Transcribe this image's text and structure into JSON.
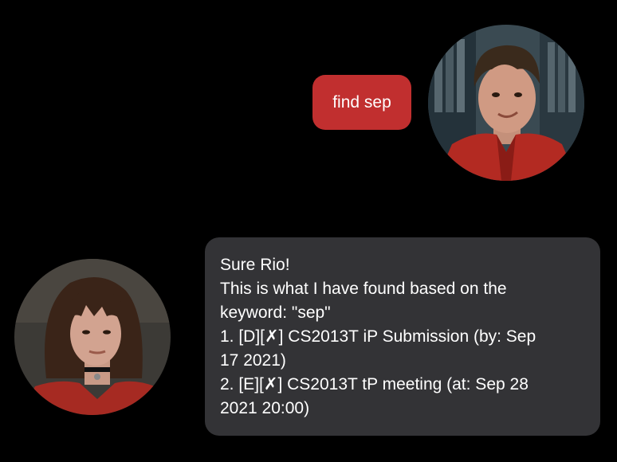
{
  "conversation": {
    "user_message": "find sep",
    "bot_message_lines": [
      "Sure Rio!",
      "This is what I have found based on the",
      "keyword: \"sep\"",
      "1. [D][✗] CS2013T iP Submission (by: Sep",
      "17 2021)",
      "2. [E][✗] CS2013T tP meeting (at: Sep 28",
      "2021 20:00)"
    ]
  },
  "colors": {
    "background": "#000000",
    "user_bubble": "#c12f2f",
    "bot_bubble": "#333336",
    "text": "#ffffff"
  }
}
